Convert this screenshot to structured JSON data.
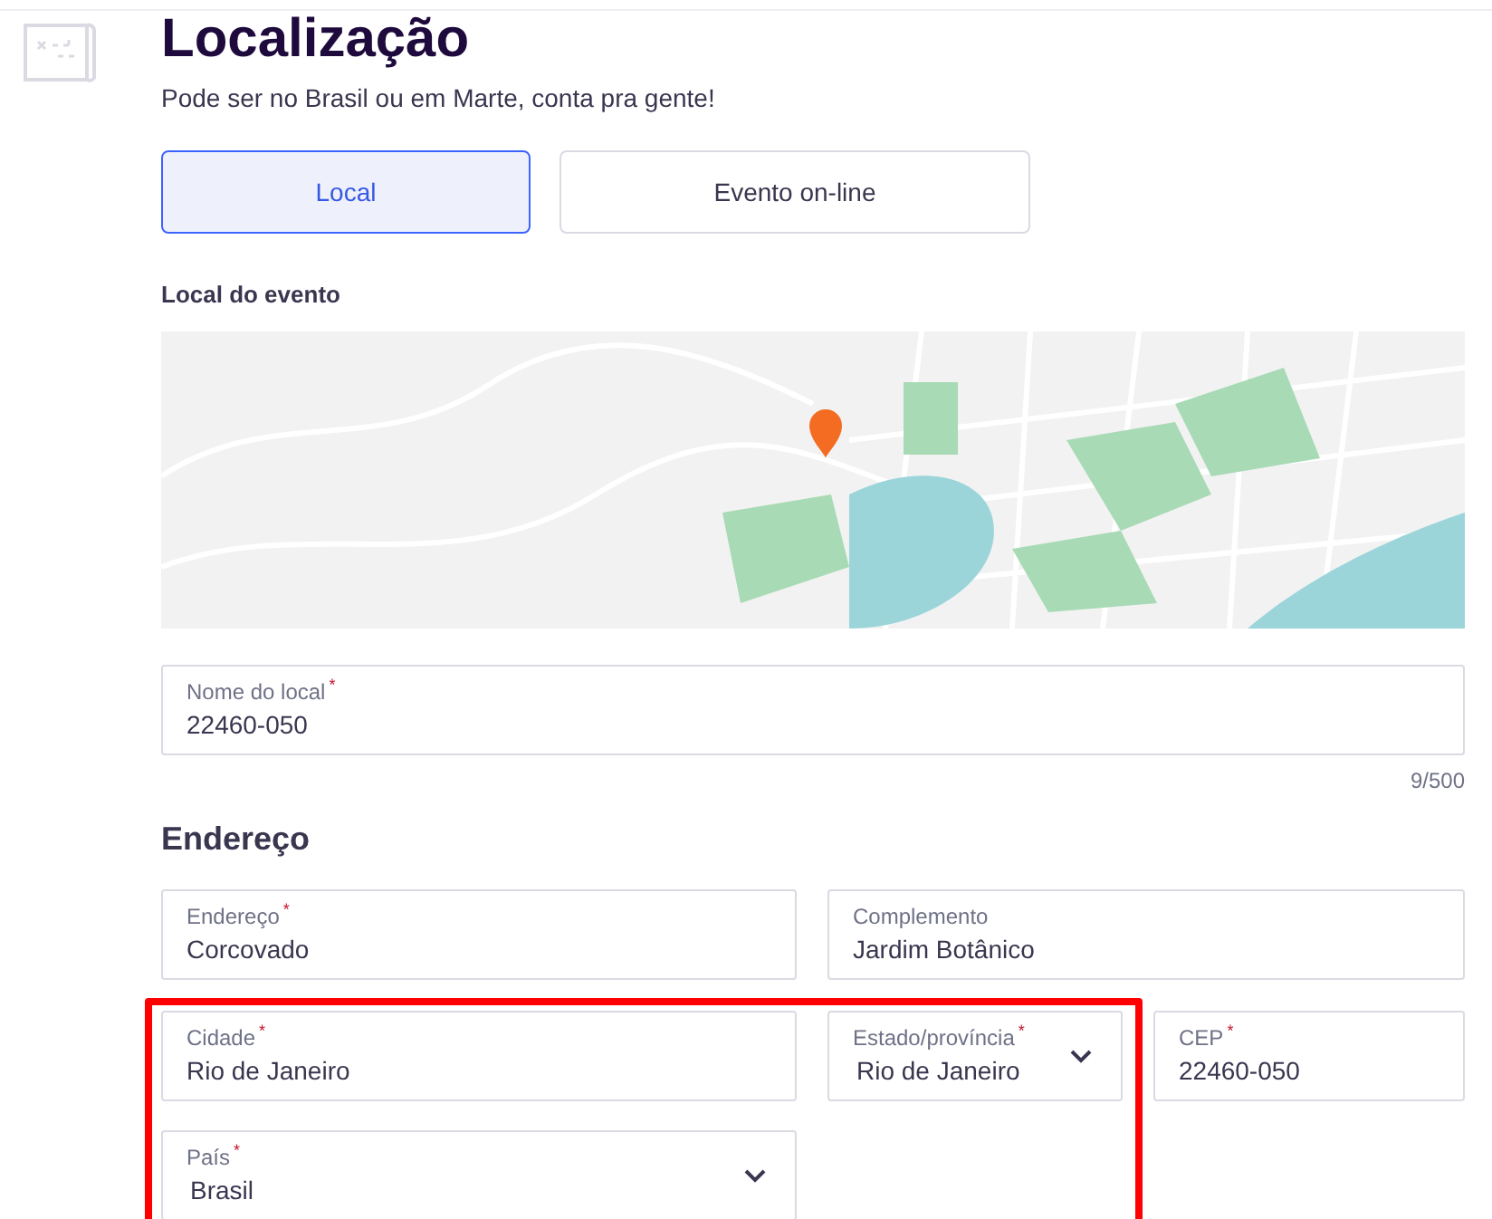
{
  "header": {
    "title": "Localização",
    "subtitle": "Pode ser no Brasil ou em Marte, conta pra gente!"
  },
  "tabs": [
    {
      "label": "Local",
      "selected": true
    },
    {
      "label": "Evento on-line",
      "selected": false
    }
  ],
  "map_label": "Local do evento",
  "required_mark": "*",
  "venue_field": {
    "label": "Nome do local",
    "required": true,
    "value": "22460-050",
    "counter": "9/500"
  },
  "address": {
    "heading": "Endereço",
    "fields": [
      {
        "kind": "text",
        "label": "Endereço",
        "required": true,
        "value": "Corcovado"
      },
      {
        "kind": "text",
        "label": "Complemento",
        "required": false,
        "value": "Jardim Botânico"
      },
      {
        "kind": "text",
        "label": "Cidade",
        "required": true,
        "value": "Rio de Janeiro"
      },
      {
        "kind": "select",
        "label": "Estado/província",
        "required": true,
        "value": "Rio de Janeiro"
      },
      {
        "kind": "text",
        "label": "CEP",
        "required": true,
        "value": "22460-050"
      },
      {
        "kind": "select",
        "label": "País",
        "required": true,
        "value": "Brasil"
      }
    ]
  }
}
